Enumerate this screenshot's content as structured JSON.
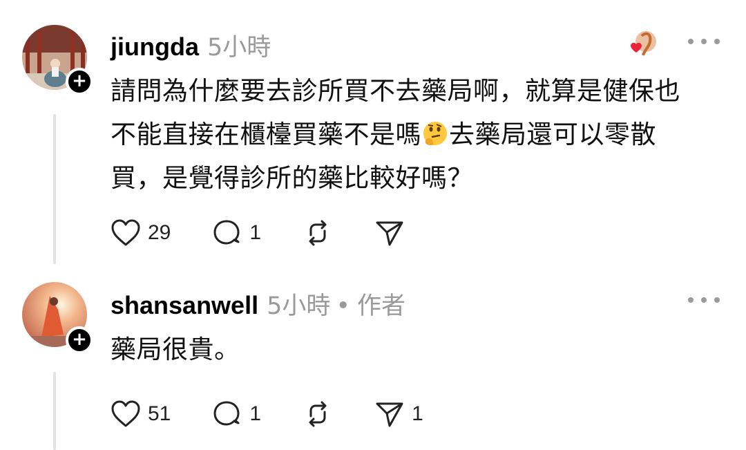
{
  "posts": [
    {
      "username": "jiungda",
      "time": "5小時",
      "author_tag": "",
      "text_lines": [
        "請問為什麼要去診所買不去藥局啊，就算是健保也",
        "不能直接在櫃檯買藥不是嗎",
        "去藥局還可以零散",
        "買，是覺得診所的藥比較好嗎？"
      ],
      "emoji": "thinking-face",
      "like_count": "29",
      "reply_count": "1",
      "share_count": ""
    },
    {
      "username": "shansanwell",
      "time": "5小時",
      "dot": "•",
      "author_tag": "作者",
      "text": "藥局很貴。",
      "like_count": "51",
      "reply_count": "1",
      "share_count": "1"
    }
  ],
  "icons": {
    "like": "heart-icon",
    "reply": "comment-icon",
    "repost": "repost-icon",
    "share": "send-icon",
    "more": "more-dots-icon",
    "follow": "plus-icon"
  },
  "colors": {
    "meta_gray": "#9a9a9a",
    "thread_line": "#e3e3e3",
    "heart_red": "#e8243a"
  }
}
